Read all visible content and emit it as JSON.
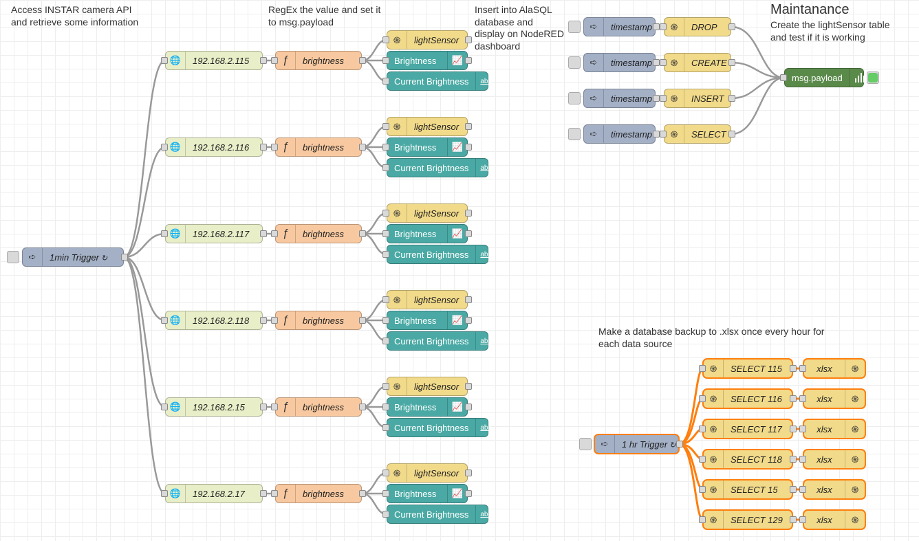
{
  "comments": {
    "c1": "Access INSTAR camera API and retrieve some information",
    "c2": "RegEx the value and set it to msg.payload",
    "c3": "Insert into AlaSQL database and display on NodeRED dashboard",
    "c4": "Maintanance",
    "c5": "Create the lightSensor table and test if it is working",
    "c6": "Make a database backup to .xlsx once every hour for each data source"
  },
  "nodes": {
    "trigger1": "1min Trigger",
    "trigger2": "1 hr Trigger",
    "ip": [
      "192.168.2.115",
      "192.168.2.116",
      "192.168.2.117",
      "192.168.2.118",
      "192.168.2.15",
      "192.168.2.17"
    ],
    "brightness": "brightness",
    "lightSensor": "lightSensor",
    "brightnessChart": "Brightness",
    "currentBrightness": "Current Brightness",
    "timestamp": "timestamp",
    "drop": "DROP",
    "create": "CREATE",
    "insert": "INSERT",
    "select": "SELECT",
    "debug": "msg.payload",
    "selectN": [
      "SELECT 115",
      "SELECT 116",
      "SELECT 117",
      "SELECT 118",
      "SELECT 15",
      "SELECT 129"
    ],
    "xlsx": "xlsx"
  },
  "icons": {
    "arrow": "➪",
    "globe": "🌐",
    "f": "ƒ",
    "swirl": "֍",
    "chart": "📈",
    "abc": "abc"
  },
  "loop": "↻"
}
